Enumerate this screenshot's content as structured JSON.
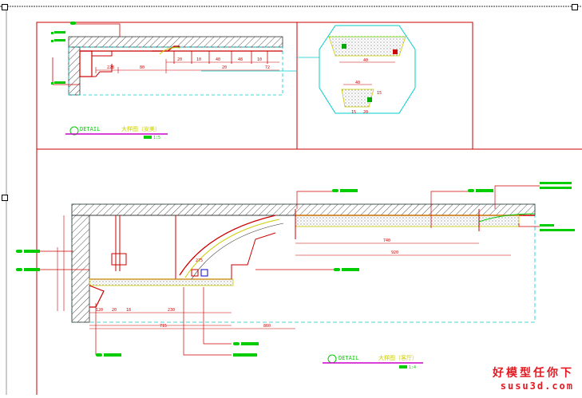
{
  "detail_top": {
    "label": "DETAIL",
    "title": "大样图（安美）",
    "scale": "1:5"
  },
  "detail_bottom": {
    "label": "DETAIL",
    "title": "大样图（客厅）",
    "scale": "1:4"
  },
  "top_dims": [
    "40",
    "40",
    "10",
    "10",
    "228",
    "80",
    "20",
    "10",
    "40",
    "48",
    "10",
    "20",
    "30",
    "10",
    "72"
  ],
  "inset_dims": [
    "40",
    "40",
    "30",
    "15",
    "15",
    "20",
    "30"
  ],
  "bottom_dims": [
    "740",
    "920",
    "10",
    "120",
    "20",
    "18",
    "30",
    "230",
    "715",
    "860",
    "10",
    "60",
    "245",
    "275"
  ],
  "watermark": {
    "line1": "好模型任你下",
    "line2": "susu3d.com"
  },
  "colors": {
    "frame": "#cc0000",
    "dim": "#cc0000",
    "leader": "#00cc00",
    "magenta": "#cc00cc",
    "cyan": "#00cccc",
    "yellow": "#cccc00",
    "hatch": "#404040"
  }
}
